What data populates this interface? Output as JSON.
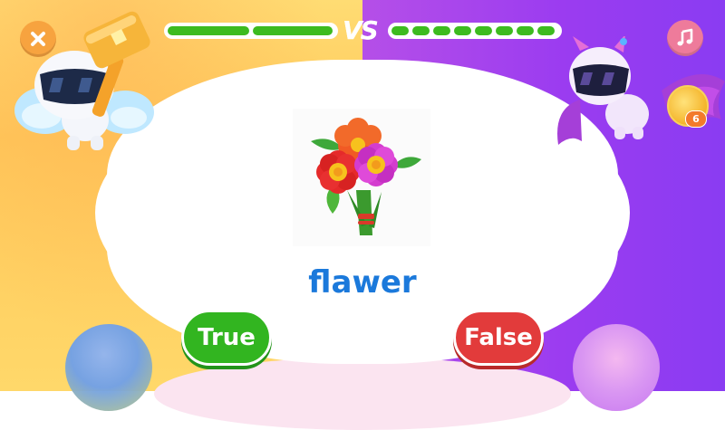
{
  "hud": {
    "vs_label": "VS",
    "player_health": {
      "segments": 2,
      "filled": 2
    },
    "opponent_health": {
      "segments": 8,
      "filled": 8
    },
    "coin_count": "6"
  },
  "question": {
    "image": "flower-bouquet-icon",
    "word": "flawer"
  },
  "answers": {
    "true_label": "True",
    "false_label": "False"
  },
  "colors": {
    "left_bg": "#ffd76a",
    "right_bg": "#9b3cf0",
    "health_green": "#3dbb1f",
    "word_blue": "#1b79db",
    "true_green": "#32b520",
    "false_red": "#e23b3b"
  }
}
